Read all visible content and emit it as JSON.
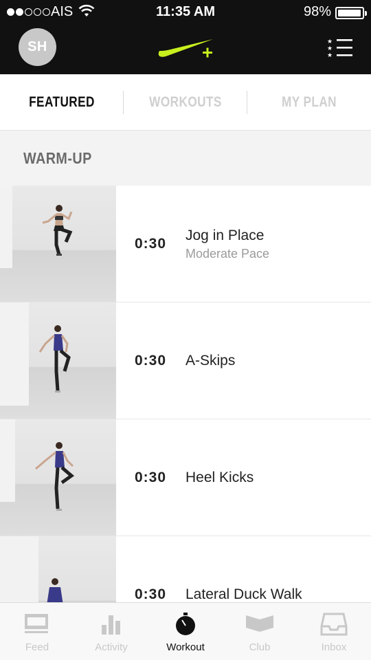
{
  "status_bar": {
    "carrier": "AIS",
    "time": "11:35 AM",
    "battery": "98%",
    "battery_level": 0.98,
    "signal_bars": 2
  },
  "header": {
    "avatar_initials": "SH",
    "logo": "nike-plus-logo",
    "menu_icon": "star-list-icon",
    "accent_color": "#c7f01e"
  },
  "tabs": [
    {
      "label": "FEATURED",
      "active": true
    },
    {
      "label": "WORKOUTS",
      "active": false
    },
    {
      "label": "MY PLAN",
      "active": false
    }
  ],
  "section": {
    "title": "WARM-UP"
  },
  "exercises": [
    {
      "duration": "0:30",
      "name": "Jog in Place",
      "subtitle": "Moderate Pace"
    },
    {
      "duration": "0:30",
      "name": "A-Skips",
      "subtitle": ""
    },
    {
      "duration": "0:30",
      "name": "Heel Kicks",
      "subtitle": ""
    },
    {
      "duration": "0:30",
      "name": "Lateral Duck Walk",
      "subtitle": ""
    }
  ],
  "bottom_nav": [
    {
      "label": "Feed",
      "icon": "feed-icon",
      "active": false
    },
    {
      "label": "Activity",
      "icon": "activity-bars-icon",
      "active": false
    },
    {
      "label": "Workout",
      "icon": "stopwatch-icon",
      "active": true
    },
    {
      "label": "Club",
      "icon": "club-icon",
      "active": false
    },
    {
      "label": "Inbox",
      "icon": "inbox-tray-icon",
      "active": false
    }
  ]
}
